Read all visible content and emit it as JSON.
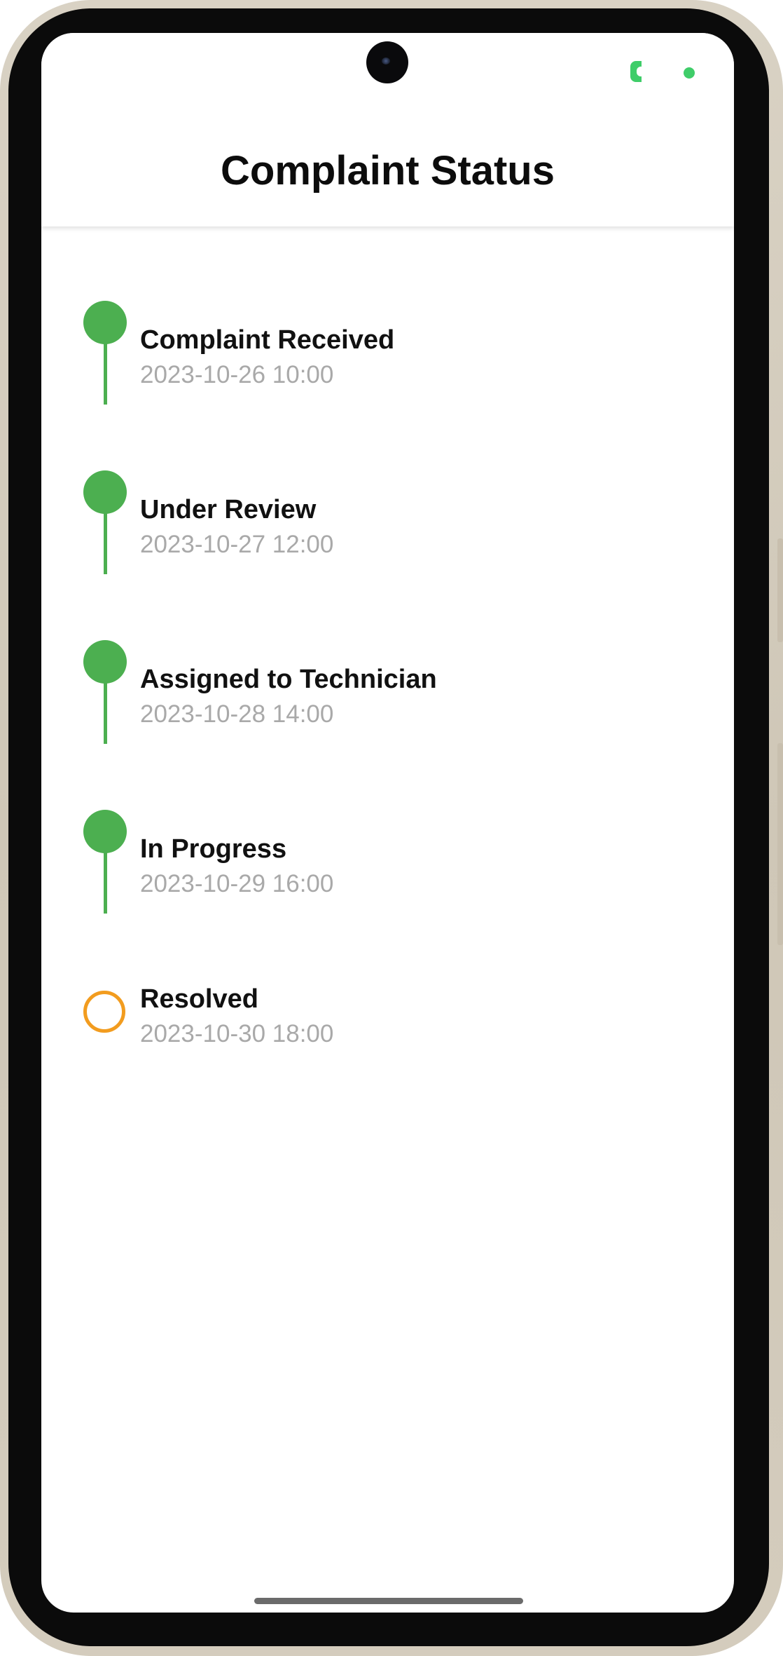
{
  "header": {
    "title": "Complaint Status"
  },
  "status_bar": {
    "indicator_color": "#3fcd69"
  },
  "timeline": {
    "steps": [
      {
        "label": "Complaint Received",
        "time": "2023-10-26 10:00",
        "state": "completed",
        "color": "#4caf50"
      },
      {
        "label": "Under Review",
        "time": "2023-10-27 12:00",
        "state": "completed",
        "color": "#4caf50"
      },
      {
        "label": "Assigned to Technician",
        "time": "2023-10-28 14:00",
        "state": "completed",
        "color": "#4caf50"
      },
      {
        "label": "In Progress",
        "time": "2023-10-29 16:00",
        "state": "completed",
        "color": "#4caf50"
      },
      {
        "label": "Resolved",
        "time": "2023-10-30 18:00",
        "state": "pending",
        "color": "#f29c1f"
      }
    ]
  },
  "colors": {
    "completed": "#4caf50",
    "pending": "#f29c1f",
    "timestamp": "#a9a9a9"
  }
}
